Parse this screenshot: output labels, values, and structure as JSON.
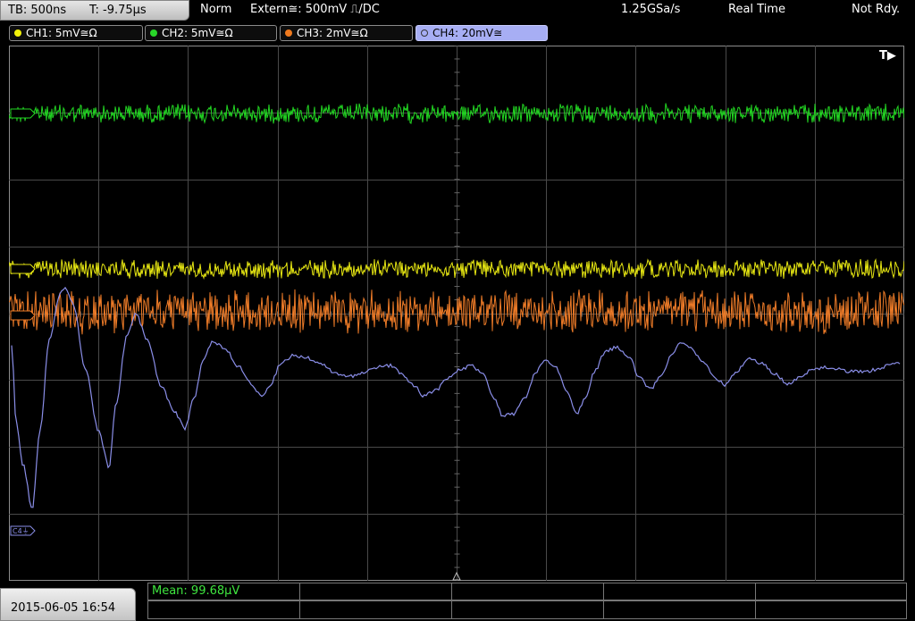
{
  "top": {
    "timebase": "TB: 500ns",
    "trigger_time": "T: -9.75µs",
    "mode": "Norm",
    "trigger_source": "Extern≅: 500mV ⎍/DC",
    "sample_rate": "1.25GSa/s",
    "acq_mode": "Real Time",
    "status": "Not Rdy."
  },
  "channels": [
    {
      "label": "CH1: 5mV≅Ω",
      "color": "#f2f20a",
      "active": false
    },
    {
      "label": "CH2: 5mV≅Ω",
      "color": "#29d629",
      "active": false
    },
    {
      "label": "CH3: 2mV≅Ω",
      "color": "#f07a1e",
      "active": false
    },
    {
      "label": "CH4: 20mV≅",
      "color": "#a7aef4",
      "active": true
    }
  ],
  "markers": {
    "trigger": "T▶",
    "ch4": "C4⏚"
  },
  "measurement": {
    "mean": "Mean: 99.68µV"
  },
  "datetime": "2015-06-05 16:54",
  "colors": {
    "ch1": "#e6e612",
    "ch2": "#22d622",
    "ch3": "#ef7c28",
    "ch4": "#8a8ee8",
    "grid": "#4a4a4a"
  }
}
